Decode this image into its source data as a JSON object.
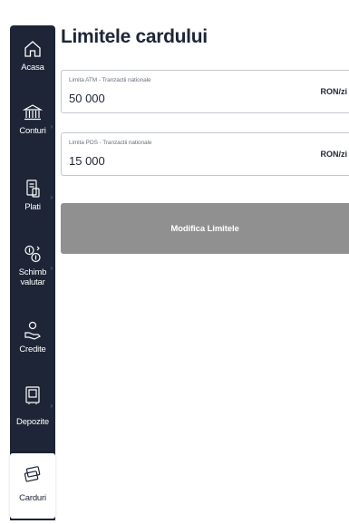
{
  "sidebar": {
    "items": [
      {
        "label": "Acasa",
        "icon": "home-icon"
      },
      {
        "label": "Conturi",
        "icon": "bank-icon"
      },
      {
        "label": "Plati",
        "icon": "payment-icon"
      },
      {
        "label": "Schimb valutar",
        "icon": "exchange-icon"
      },
      {
        "label": "Credite",
        "icon": "credit-icon"
      },
      {
        "label": "Depozite",
        "icon": "deposit-icon"
      },
      {
        "label": "Carduri",
        "icon": "card-icon"
      }
    ],
    "chevron": "›",
    "colors": {
      "background": "#1d2536",
      "active_background": "#ffffff"
    }
  },
  "page": {
    "title": "Limitele cardului"
  },
  "limits": [
    {
      "label": "Limita ATM - Tranzactii nationale",
      "value": "50 000",
      "unit": "RON/zi"
    },
    {
      "label": "Limita POS - Tranzactii nationale",
      "value": "15 000",
      "unit": "RON/zi"
    }
  ],
  "actions": {
    "modify_label": "Modifica Limitele",
    "button_color": "#909090"
  }
}
